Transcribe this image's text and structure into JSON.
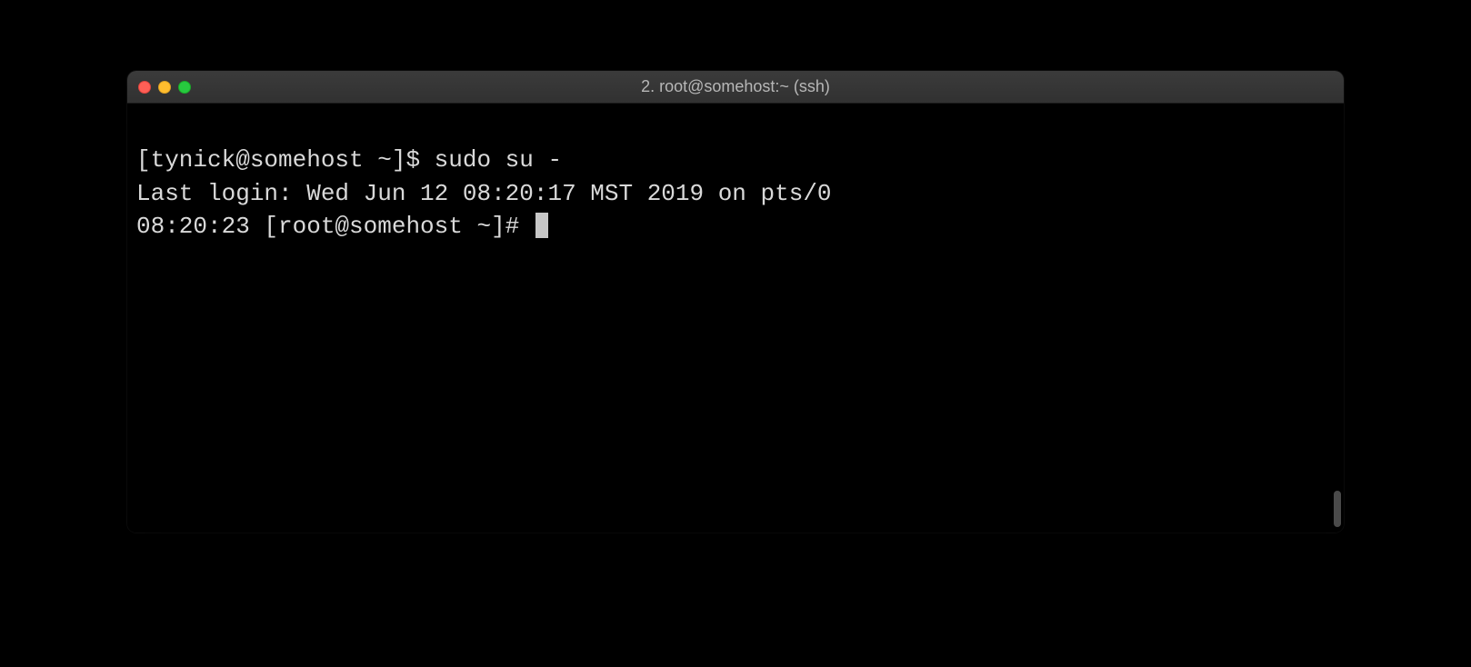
{
  "window": {
    "title": "2. root@somehost:~ (ssh)"
  },
  "terminal": {
    "lines": {
      "l1_prompt": "[tynick@somehost ~]$ ",
      "l1_command": "sudo su -",
      "l2": "Last login: Wed Jun 12 08:20:17 MST 2019 on pts/0",
      "l3_prompt": "08:20:23 [root@somehost ~]# "
    }
  },
  "colors": {
    "close": "#ff5f56",
    "minimize": "#ffbd2e",
    "maximize": "#27c93f",
    "bg": "#000000",
    "fg": "#d9d9d9"
  }
}
